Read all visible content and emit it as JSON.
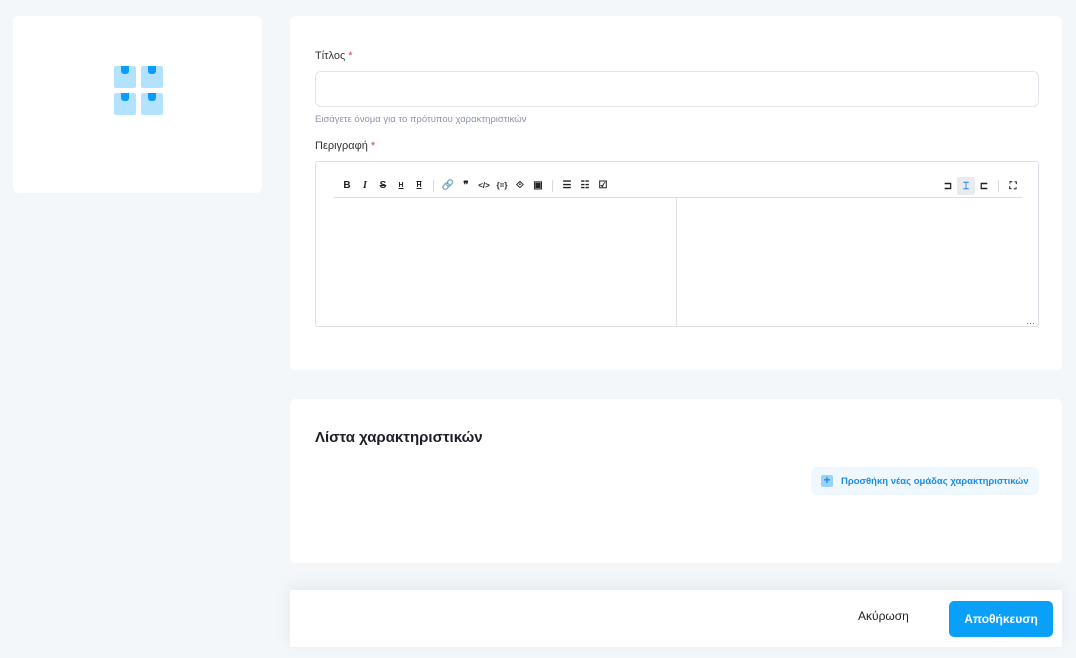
{
  "form": {
    "title_label": "Τίτλος",
    "required_mark": "*",
    "title_value": "",
    "title_hint": "Εισάγετε όνομα για το πρότυπου χαρακτηριστικών",
    "description_label": "Περιγραφή",
    "toolbar": {
      "left": [
        {
          "name": "bold",
          "glyph": "B"
        },
        {
          "name": "italic",
          "glyph": "I"
        },
        {
          "name": "strikethrough",
          "glyph": "S"
        },
        {
          "name": "heading-bigger",
          "glyph": "H"
        },
        {
          "name": "heading-smaller",
          "glyph": "H"
        },
        {
          "sep": true
        },
        {
          "name": "link",
          "glyph": "🔗"
        },
        {
          "name": "quote",
          "glyph": "❞"
        },
        {
          "name": "code",
          "glyph": "</>"
        },
        {
          "name": "code-block",
          "glyph": "{=}"
        },
        {
          "name": "comment",
          "glyph": "⟐"
        },
        {
          "name": "image",
          "glyph": "▣"
        },
        {
          "sep": true
        },
        {
          "name": "unordered-list",
          "glyph": "☰"
        },
        {
          "name": "ordered-list",
          "glyph": "☷"
        },
        {
          "name": "checklist",
          "glyph": "☑"
        }
      ],
      "right": [
        {
          "name": "edit-mode",
          "glyph": "⊐"
        },
        {
          "name": "live-mode",
          "glyph": "⌶",
          "active": true
        },
        {
          "name": "preview-mode",
          "glyph": "⊏"
        },
        {
          "sep": true
        },
        {
          "name": "fullscreen",
          "glyph": "⛶"
        }
      ]
    },
    "editor_value": "",
    "preview_value": ""
  },
  "features": {
    "title": "Λίστα χαρακτηριστικών",
    "add_group_label": "Προσθήκη νέας ομάδας χαρακτηριστικών"
  },
  "footer": {
    "cancel_label": "Ακύρωση",
    "save_label": "Αποθήκευση"
  },
  "colors": {
    "accent": "#0aa0fa",
    "background": "#f3f7fa",
    "required": "#e5394b"
  }
}
